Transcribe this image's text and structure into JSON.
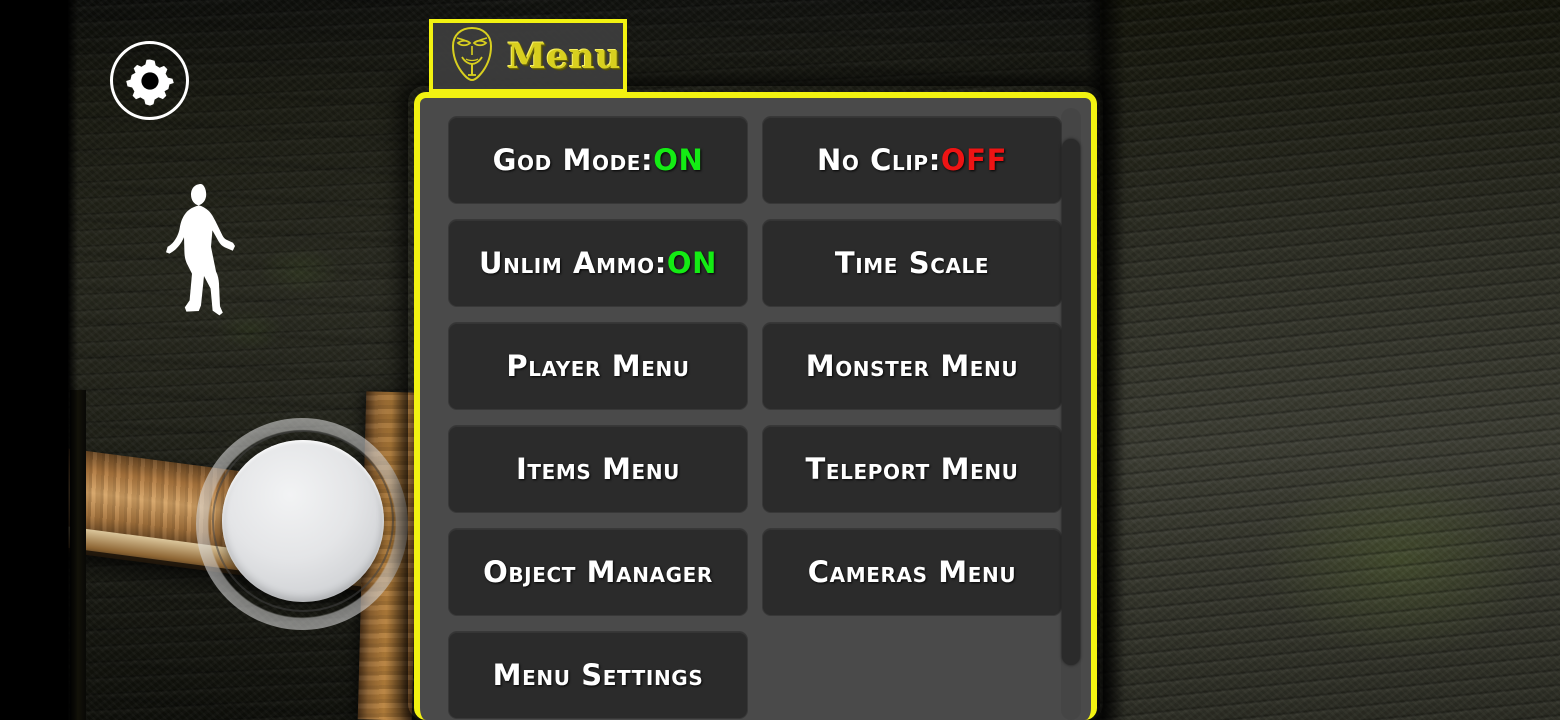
{
  "app": {
    "title": "Menu",
    "accent_color": "#f2f211",
    "panel_bg": "#4a4a4a",
    "button_bg": "#2b2b2b",
    "on_color": "#14ec14",
    "off_color": "#ee1414"
  },
  "hud": {
    "settings_button": {
      "icon": "gear-icon",
      "label": ""
    },
    "player_indicator": {
      "icon": "player-silhouette-icon",
      "label": ""
    },
    "joystick": {
      "icon": "virtual-joystick",
      "label": ""
    }
  },
  "menu_tab": {
    "icon": "anonymous-mask-icon",
    "label": "Menu"
  },
  "mod_menu": {
    "scroll": {
      "thumb_top_pct": 5,
      "thumb_height_pct": 86
    },
    "buttons": [
      {
        "label": "God Mode:",
        "value": "ON",
        "state": "on",
        "name": "god-mode-button"
      },
      {
        "label": "No Clip:",
        "value": "OFF",
        "state": "off",
        "name": "no-clip-button"
      },
      {
        "label": "Unlim Ammo:",
        "value": "ON",
        "state": "on",
        "name": "unlim-ammo-button"
      },
      {
        "label": "Time Scale",
        "value": "",
        "state": "",
        "name": "time-scale-button"
      },
      {
        "label": "Player Menu",
        "value": "",
        "state": "",
        "name": "player-menu-button"
      },
      {
        "label": "Monster Menu",
        "value": "",
        "state": "",
        "name": "monster-menu-button"
      },
      {
        "label": "Items Menu",
        "value": "",
        "state": "",
        "name": "items-menu-button"
      },
      {
        "label": "Teleport Menu",
        "value": "",
        "state": "",
        "name": "teleport-menu-button"
      },
      {
        "label": "Object Manager",
        "value": "",
        "state": "",
        "name": "object-manager-button"
      },
      {
        "label": "Cameras Menu",
        "value": "",
        "state": "",
        "name": "cameras-menu-button"
      },
      {
        "label": "Menu Settings",
        "value": "",
        "state": "",
        "name": "menu-settings-button"
      },
      {
        "label": "",
        "value": "",
        "state": "empty",
        "name": "empty-slot"
      }
    ]
  }
}
